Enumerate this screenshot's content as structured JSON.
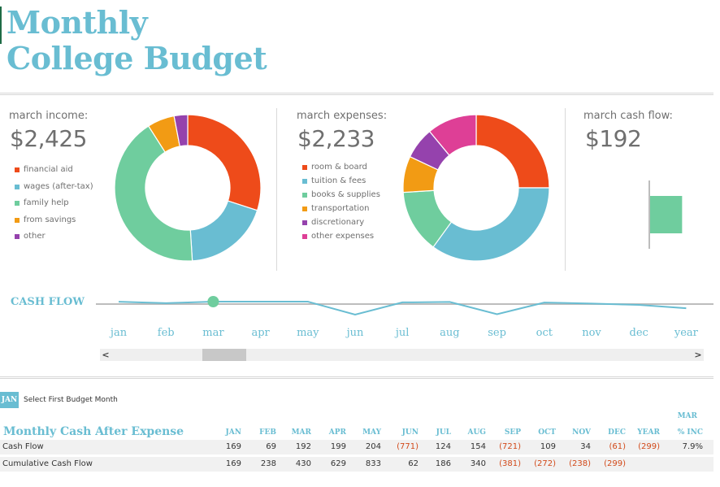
{
  "title": {
    "line1": "Monthly",
    "line2": "College Budget"
  },
  "colors": {
    "accent": "#69bdd2",
    "negative": "#d24a1a",
    "orange_red": "#ee4b1a",
    "blue": "#69bdd2",
    "green": "#6fcd9e",
    "orange": "#f29b14",
    "purple": "#9542ad",
    "pink": "#de3f96",
    "text_gray": "#6f6f6f"
  },
  "income": {
    "label": "march income:",
    "value": "$2,425",
    "legend": [
      {
        "label": "financial aid",
        "color": "#ee4b1a"
      },
      {
        "label": "wages (after-tax)",
        "color": "#69bdd2"
      },
      {
        "label": "family help",
        "color": "#6fcd9e"
      },
      {
        "label": "from savings",
        "color": "#f29b14"
      },
      {
        "label": "other",
        "color": "#9542ad"
      }
    ]
  },
  "expenses": {
    "label": "march expenses:",
    "value": "$2,233",
    "legend": [
      {
        "label": "room & board",
        "color": "#ee4b1a"
      },
      {
        "label": "tuition & fees",
        "color": "#69bdd2"
      },
      {
        "label": "books & supplies",
        "color": "#6fcd9e"
      },
      {
        "label": "transportation",
        "color": "#f29b14"
      },
      {
        "label": "discretionary",
        "color": "#9542ad"
      },
      {
        "label": "other expenses",
        "color": "#de3f96"
      }
    ]
  },
  "cashflow_panel": {
    "label": "march cash flow:",
    "value": "$192"
  },
  "chart_data": [
    {
      "type": "pie",
      "title": "march income",
      "donut": true,
      "categories": [
        "financial aid",
        "wages (after-tax)",
        "family help",
        "from savings",
        "other"
      ],
      "values": [
        30,
        19,
        42,
        6,
        3
      ],
      "unit": "percent (estimated)"
    },
    {
      "type": "pie",
      "title": "march expenses",
      "donut": true,
      "categories": [
        "room & board",
        "tuition & fees",
        "books & supplies",
        "transportation",
        "discretionary",
        "other expenses"
      ],
      "values": [
        25,
        35,
        14,
        8,
        7,
        11
      ],
      "unit": "percent (estimated)"
    },
    {
      "type": "bar",
      "title": "march cash flow",
      "categories": [
        "mar"
      ],
      "values": [
        192
      ]
    },
    {
      "type": "line",
      "title": "CASH FLOW",
      "categories": [
        "jan",
        "feb",
        "mar",
        "apr",
        "may",
        "jun",
        "jul",
        "aug",
        "sep",
        "oct",
        "nov",
        "dec",
        "year"
      ],
      "values": [
        169,
        69,
        192,
        199,
        204,
        -771,
        124,
        154,
        -721,
        109,
        34,
        -61,
        -299
      ],
      "highlight": "mar",
      "baseline": 0
    }
  ],
  "cashflow_line": {
    "label": "CASH FLOW",
    "months": [
      "jan",
      "feb",
      "mar",
      "apr",
      "may",
      "jun",
      "jul",
      "aug",
      "sep",
      "oct",
      "nov",
      "dec",
      "year"
    ]
  },
  "scrollbar": {
    "left_arrow": "<",
    "right_arrow": ">",
    "position": 0.12
  },
  "selector": {
    "button": "JAN",
    "caption": "Select First Budget Month"
  },
  "table": {
    "title": "Monthly Cash After Expense",
    "mar_label": "MAR",
    "columns": [
      "JAN",
      "FEB",
      "MAR",
      "APR",
      "MAY",
      "JUN",
      "JUL",
      "AUG",
      "SEP",
      "OCT",
      "NOV",
      "DEC",
      "YEAR",
      "% INC"
    ],
    "rows": [
      {
        "label": "Cash Flow",
        "cells": [
          "169",
          "69",
          "192",
          "199",
          "204",
          "(771)",
          "124",
          "154",
          "(721)",
          "109",
          "34",
          "(61)",
          "(299)",
          "7.9%"
        ]
      },
      {
        "label": "Cumulative Cash Flow",
        "cells": [
          "169",
          "238",
          "430",
          "629",
          "833",
          "62",
          "186",
          "340",
          "(381)",
          "(272)",
          "(238)",
          "(299)",
          "",
          ""
        ]
      }
    ]
  }
}
